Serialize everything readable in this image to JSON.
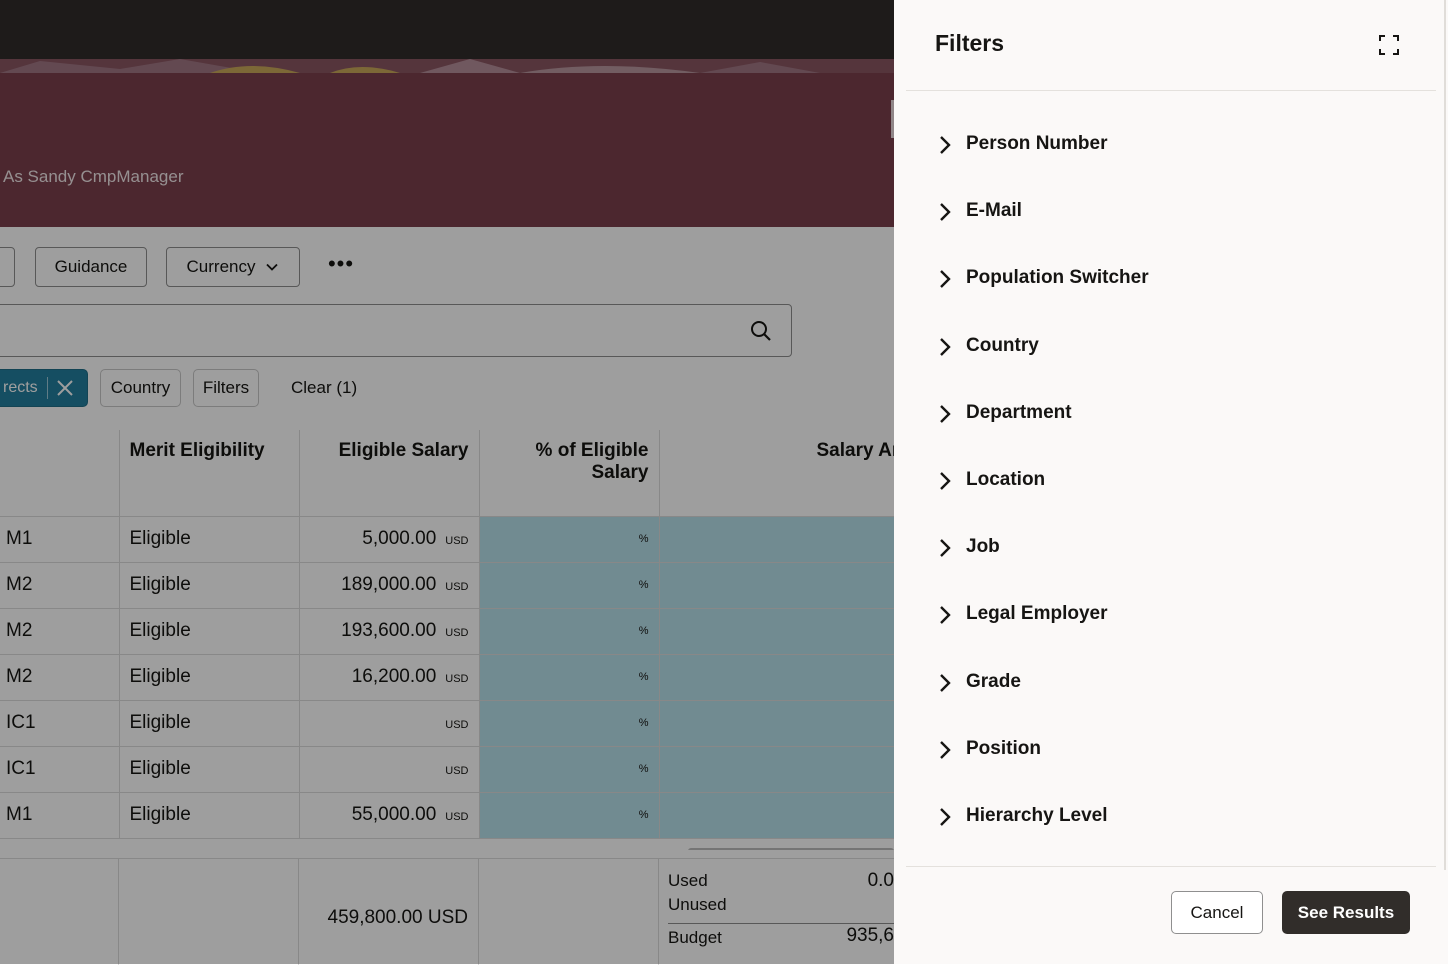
{
  "banner": {
    "user_text": "As Sandy CmpManager"
  },
  "toolbar": {
    "guidance_label": "Guidance",
    "currency_label": "Currency",
    "more_label": "•••"
  },
  "chips": {
    "active_label": "rects",
    "country_label": "Country",
    "filters_label": "Filters",
    "clear_label": "Clear (1)"
  },
  "table": {
    "headers": [
      "",
      "Merit Eligibility",
      "Eligible Salary",
      "% of Eligible Salary",
      "Salary Ar"
    ],
    "rows": [
      {
        "grade": "M1",
        "eligibility": "Eligible",
        "salary": "5,000.00",
        "unit": "USD",
        "pct": "%"
      },
      {
        "grade": "M2",
        "eligibility": "Eligible",
        "salary": "189,000.00",
        "unit": "USD",
        "pct": "%"
      },
      {
        "grade": "M2",
        "eligibility": "Eligible",
        "salary": "193,600.00",
        "unit": "USD",
        "pct": "%"
      },
      {
        "grade": "M2",
        "eligibility": "Eligible",
        "salary": "16,200.00",
        "unit": "USD",
        "pct": "%"
      },
      {
        "grade": "IC1",
        "eligibility": "Eligible",
        "salary": "",
        "unit": "USD",
        "pct": "%"
      },
      {
        "grade": "IC1",
        "eligibility": "Eligible",
        "salary": "",
        "unit": "USD",
        "pct": "%"
      },
      {
        "grade": "M1",
        "eligibility": "Eligible",
        "salary": "55,000.00",
        "unit": "USD",
        "pct": "%"
      }
    ]
  },
  "totals": {
    "eligible_salary": "459,800.00 USD",
    "used_label": "Used",
    "used_value": "0.0",
    "unused_label": "Unused",
    "budget_label": "Budget",
    "budget_value": "935,6"
  },
  "drawer": {
    "title": "Filters",
    "items": [
      "Person Number",
      "E-Mail",
      "Population Switcher",
      "Country",
      "Department",
      "Location",
      "Job",
      "Legal Employer",
      "Grade",
      "Position",
      "Hierarchy Level"
    ],
    "cancel_label": "Cancel",
    "see_results_label": "See Results"
  },
  "colors": {
    "topbar": "#312d2a",
    "banner": "#7b3f4c",
    "chip_active": "#227e9e",
    "editable_cell": "#b7e0ea",
    "primary_button": "#312d2a"
  },
  "icons": [
    "search-icon",
    "close-icon",
    "chevron-down-icon",
    "chevron-right-icon",
    "expand-icon"
  ]
}
